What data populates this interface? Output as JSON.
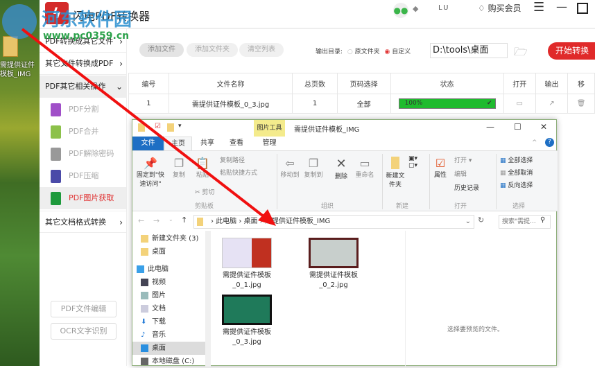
{
  "desktop": {
    "icon_label": "需提供证件模板_IMG"
  },
  "watermark": {
    "name": "河东软件园",
    "url": "www.pc0359.cn"
  },
  "app": {
    "title": "闪电PDF转换器",
    "user": "LU",
    "vip": "购买会员"
  },
  "sidebar": {
    "sections": [
      {
        "label": "PDF转换成其它文件"
      },
      {
        "label": "其它文件转换成PDF"
      },
      {
        "label": "PDF其它相关操作"
      }
    ],
    "subitems": [
      {
        "label": "PDF分割",
        "color": "#a04fc8"
      },
      {
        "label": "PDF合并",
        "color": "#8cc14a"
      },
      {
        "label": "PDF解除密码",
        "color": "#999999"
      },
      {
        "label": "PDF压缩",
        "color": "#4a4aa8"
      },
      {
        "label": "PDF图片获取",
        "color": "#1e9a3c"
      }
    ],
    "other": "其它文档格式转换",
    "buttons": [
      "PDF文件编辑",
      "OCR文字识别"
    ]
  },
  "toolbar": {
    "add_file": "添加文件",
    "add_folder": "添加文件夹",
    "clear": "清空列表",
    "output_label": "输出目录:",
    "opt_source": "原文件夹",
    "opt_custom": "自定义",
    "path": "D:\\tools\\桌面",
    "start": "开始转换"
  },
  "table": {
    "headers": [
      "编号",
      "文件名称",
      "总页数",
      "页码选择",
      "状态",
      "打开",
      "输出",
      "移"
    ],
    "rows": [
      {
        "no": "1",
        "name": "需提供证件模板_0_3.jpg",
        "pages": "1",
        "range": "全部",
        "status": "100%",
        "progress": 100
      }
    ]
  },
  "explorer": {
    "title": "需提供证件模板_IMG",
    "pic_tools": "图片工具",
    "tabs": [
      "文件",
      "主页",
      "共享",
      "查看",
      "管理"
    ],
    "ribbon": {
      "pin": "固定到\"快速访问\"",
      "copy": "复制",
      "paste": "粘贴",
      "copy_path": "复制路径",
      "paste_shortcut": "粘贴快捷方式",
      "cut": "剪切",
      "clipboard": "剪贴板",
      "move_to": "移动到",
      "copy_to": "复制到",
      "delete": "删除",
      "rename": "重命名",
      "organize": "组织",
      "new_folder": "新建文件夹",
      "new": "新建",
      "properties": "属性",
      "open": "打开",
      "edit": "编辑",
      "history": "历史记录",
      "open_group": "打开",
      "select_all": "全部选择",
      "select_none": "全部取消",
      "invert": "反向选择",
      "select_group": "选择"
    },
    "address": [
      "此电脑",
      "桌面",
      "需提供证件模板_IMG"
    ],
    "search_placeholder": "搜索\"需提...",
    "nav": [
      "新建文件夹 (3)",
      "桌面",
      "此电脑",
      "视频",
      "图片",
      "文档",
      "下载",
      "音乐",
      "桌面",
      "本地磁盘 (C:)"
    ],
    "files": [
      {
        "line1": "需提供证件模板",
        "line2": "_0_1.jpg"
      },
      {
        "line1": "需提供证件模板",
        "line2": "_0_2.jpg"
      },
      {
        "line1": "需提供证件模板",
        "line2": "_0_3.jpg"
      }
    ],
    "preview": "选择要预览的文件。"
  }
}
